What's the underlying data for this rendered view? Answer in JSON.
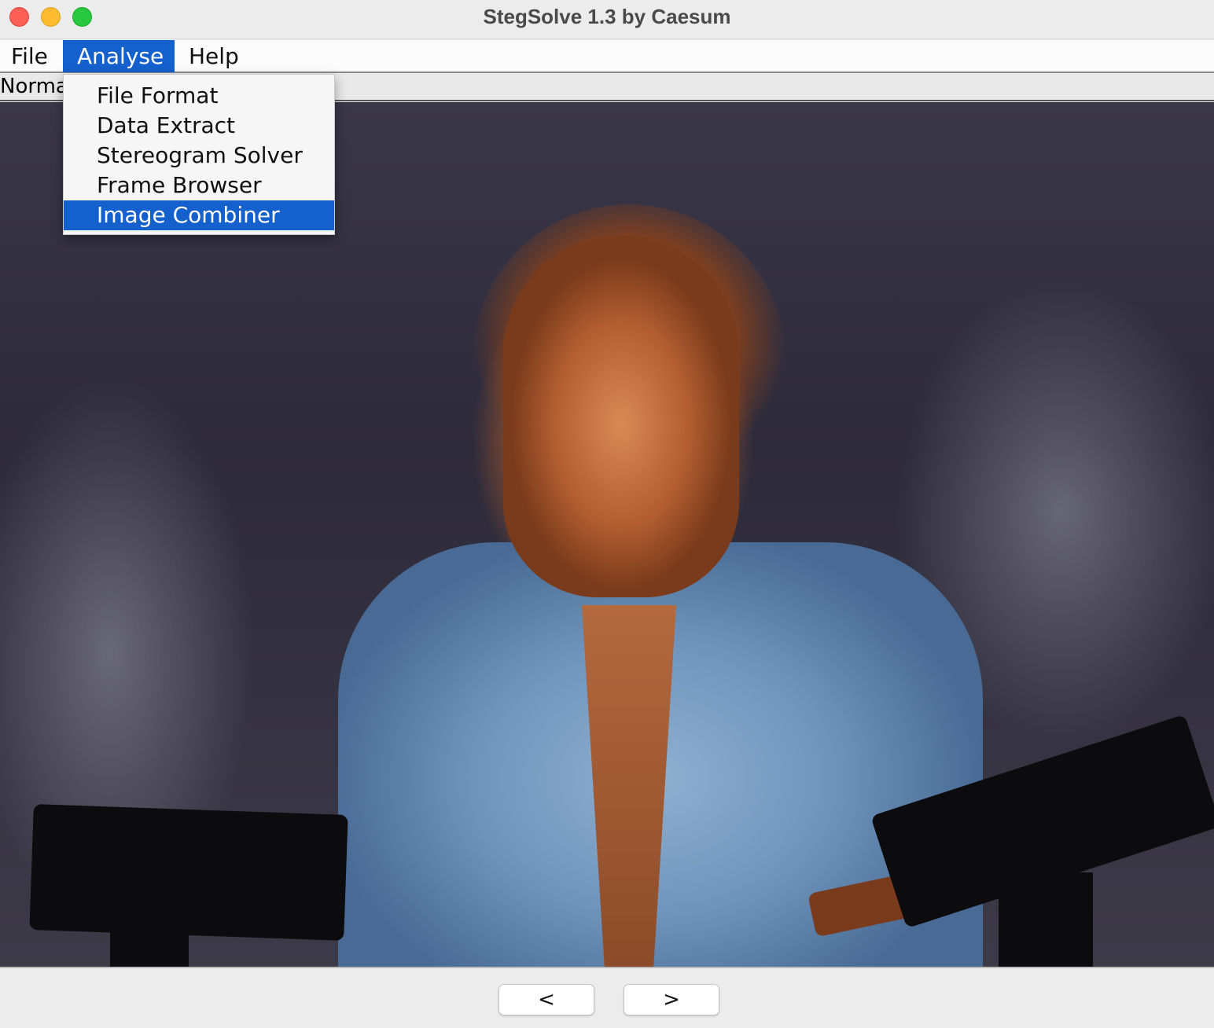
{
  "window": {
    "title": "StegSolve 1.3 by Caesum"
  },
  "menubar": {
    "items": [
      {
        "label": "File"
      },
      {
        "label": "Analyse"
      },
      {
        "label": "Help"
      }
    ]
  },
  "view": {
    "label": "Normal Image"
  },
  "analyse_menu": {
    "items": [
      {
        "label": "File Format"
      },
      {
        "label": "Data Extract"
      },
      {
        "label": "Stereogram Solver"
      },
      {
        "label": "Frame Browser"
      },
      {
        "label": "Image Combiner"
      }
    ],
    "selected": "Image Combiner"
  },
  "navigation": {
    "prev_label": "<",
    "next_label": ">"
  },
  "colors": {
    "selection": "#1460cc",
    "close": "#fe5f57",
    "minimize": "#febc2e",
    "maximize": "#28c840"
  }
}
